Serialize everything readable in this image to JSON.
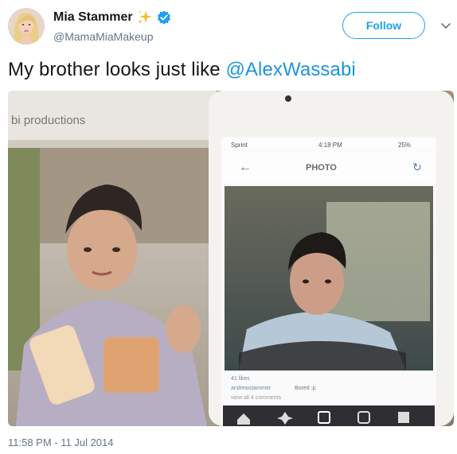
{
  "author": {
    "display_name": "Mia Stammer",
    "sparkle_emoji": "✨",
    "handle": "@MamaMiaMakeup",
    "verified_color": "#1da1f2"
  },
  "actions": {
    "follow_label": "Follow",
    "more_icon": "chevron-down-icon"
  },
  "tweet": {
    "text_before": "My brother looks just like ",
    "mention": "@AlexWassabi",
    "timestamp": "11:58 PM - 11 Jul 2014"
  },
  "photo": {
    "banner_text": "bi productions",
    "phone_header": "PHOTO",
    "phone_carrier": "Sprint",
    "phone_time": "4:18 PM",
    "phone_battery": "25%",
    "post_likes": "41 likes",
    "post_username": "andrewstammer",
    "post_caption": "Bored :p",
    "post_comments": "view all 4 comments"
  },
  "colors": {
    "accent": "#1da1f2",
    "mention": "#1b95e0",
    "secondary_text": "#657786"
  }
}
